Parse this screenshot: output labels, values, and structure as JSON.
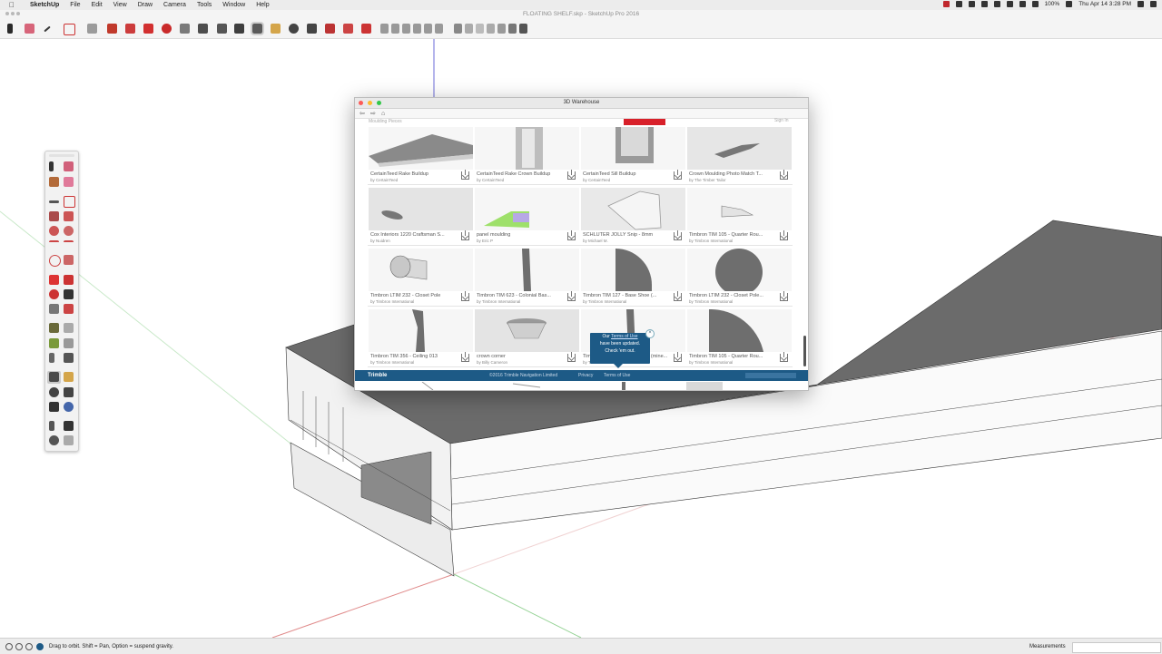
{
  "menubar": {
    "apple": "",
    "app_name": "SketchUp",
    "items": [
      "File",
      "Edit",
      "View",
      "Draw",
      "Camera",
      "Tools",
      "Window",
      "Help"
    ],
    "battery": "100%",
    "clock": "Thu Apr 14  3:28 PM"
  },
  "window": {
    "title": "FLOATING SHELF.skp - SketchUp Pro 2016"
  },
  "warehouse": {
    "title": "3D Warehouse",
    "partial_header": "Moulding Pieces",
    "sign_in": "Sign In",
    "cards": [
      {
        "title": "CertainTeed Rake Buildup",
        "author": "by CertainTeed"
      },
      {
        "title": "CertainTeed Rake Crown Buildup",
        "author": "by CertainTeed"
      },
      {
        "title": "CertainTeed Sill Buildup",
        "author": "by CertainTeed"
      },
      {
        "title": "Crown Moulding Photo Match T...",
        "author": "by The Timber Tailor"
      },
      {
        "title": "Cox Interiors 1220 Craftsman S...",
        "author": "by Nuidren"
      },
      {
        "title": "panel moulding",
        "author": "by Eric P"
      },
      {
        "title": "SCHLUTER JOLLY Snip - 8mm",
        "author": "by Michael M."
      },
      {
        "title": "Timbron TIM 105 - Quarter Rou...",
        "author": "by Timbron International"
      },
      {
        "title": "Timbron LTIM 232 - Closet Pole",
        "author": "by Timbron International"
      },
      {
        "title": "Timbron TIM 623 - Colonial Bas...",
        "author": "by Timbron International"
      },
      {
        "title": "Timbron TIM 127 - Base Shoe (...",
        "author": "by Timbron International"
      },
      {
        "title": "Timbron LTIM 232 - Closet Pole...",
        "author": "by Timbron International"
      },
      {
        "title": "Timbron TIM 356 - Ceiling 013",
        "author": "by Timbron International"
      },
      {
        "title": "crown corner",
        "author": "by Billy Cameron"
      },
      {
        "title": "Timbron TIM 127 - Base Shoe (mine...",
        "author": "by Timbron International"
      },
      {
        "title": "Timbron TIM 105 - Quarter Rou...",
        "author": "by Timbron International"
      }
    ],
    "footer": {
      "brand": "Trimble",
      "copyright": "©2016 Trimble Navigation Limited",
      "privacy": "Privacy",
      "terms": "Terms of Use"
    },
    "tooltip": {
      "line1_prefix": "Our ",
      "link": "Terms of Use",
      "line2": "have been updated.",
      "line3": "Check 'em out."
    }
  },
  "status": {
    "hint": "Drag to orbit. Shift = Pan, Option = suspend gravity.",
    "measurements_label": "Measurements"
  },
  "colors": {
    "footer_blue": "#1d5a86",
    "warehouse_red": "#d8202a",
    "model_top": "#6e6e6e"
  }
}
